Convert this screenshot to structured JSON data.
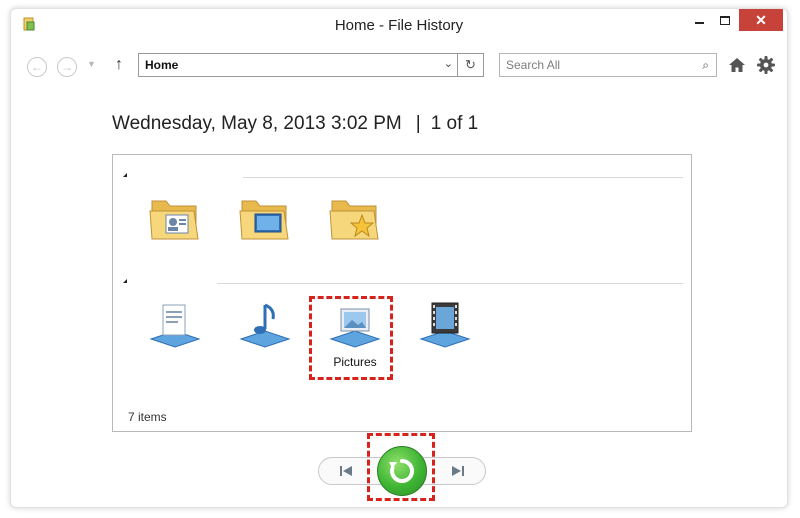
{
  "window": {
    "title": "Home - File History",
    "controls": {
      "minimize": "minimize-icon",
      "maximize": "maximize-icon",
      "close": "✕"
    }
  },
  "nav": {
    "back_icon": "back-arrow-icon",
    "forward_icon": "forward-arrow-icon",
    "up_icon": "↑",
    "address_value": "Home",
    "dropdown_icon": "⌄",
    "refresh_icon": "↻",
    "search_placeholder": "Search All",
    "search_icon": "⌕",
    "home_icon": "home-icon",
    "settings_icon": "gear-icon"
  },
  "snapshot": {
    "date": "Wednesday, May 8, 2013 3:02 PM",
    "separator": "|",
    "position": "1 of 1"
  },
  "groups": [
    {
      "items": [
        {
          "icon": "contacts-folder-icon",
          "label": ""
        },
        {
          "icon": "desktop-folder-icon",
          "label": ""
        },
        {
          "icon": "favorites-folder-icon",
          "label": ""
        }
      ]
    },
    {
      "items": [
        {
          "icon": "documents-library-icon",
          "label": ""
        },
        {
          "icon": "music-library-icon",
          "label": ""
        },
        {
          "icon": "pictures-library-icon",
          "label": "Pictures",
          "highlighted": true
        },
        {
          "icon": "videos-library-icon",
          "label": ""
        }
      ]
    }
  ],
  "status": {
    "items_count": "7 items"
  },
  "playback": {
    "previous_icon": "previous-version-icon",
    "restore_icon": "restore-icon",
    "next_icon": "next-version-icon",
    "restore_highlighted": true
  },
  "colors": {
    "close_button": "#c7433a",
    "highlight": "#d6231e",
    "restore_green": "#3fb534",
    "folder_yellow": "#f2cf6b",
    "library_blue": "#4b8fd1"
  }
}
